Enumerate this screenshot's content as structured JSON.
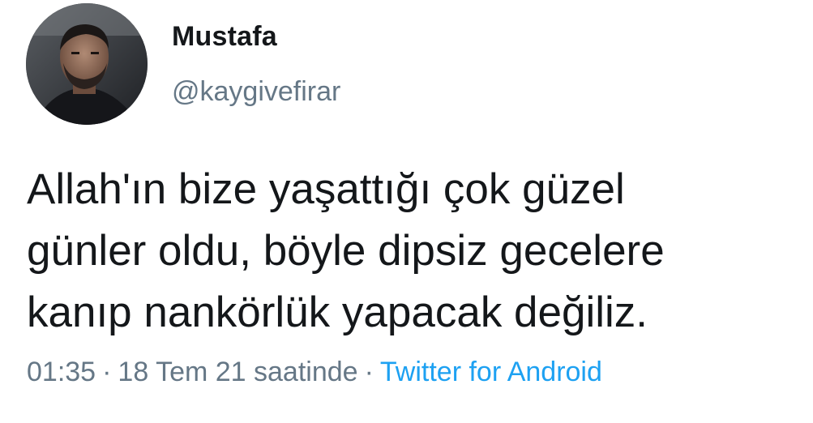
{
  "author": {
    "display_name": "Mustafa",
    "handle": "@kaygivefirar"
  },
  "tweet": {
    "text": "Allah'ın bize yaşattığı çok güzel\ngünler oldu, böyle dipsiz gecelere\nkanıp nankörlük yapacak değiliz."
  },
  "meta": {
    "time": "01:35",
    "separator": "·",
    "date": "18 Tem 21 saatinde",
    "source": "Twitter for Android"
  },
  "colors": {
    "text": "#14171a",
    "secondary": "#657786",
    "link": "#1da1f2"
  }
}
